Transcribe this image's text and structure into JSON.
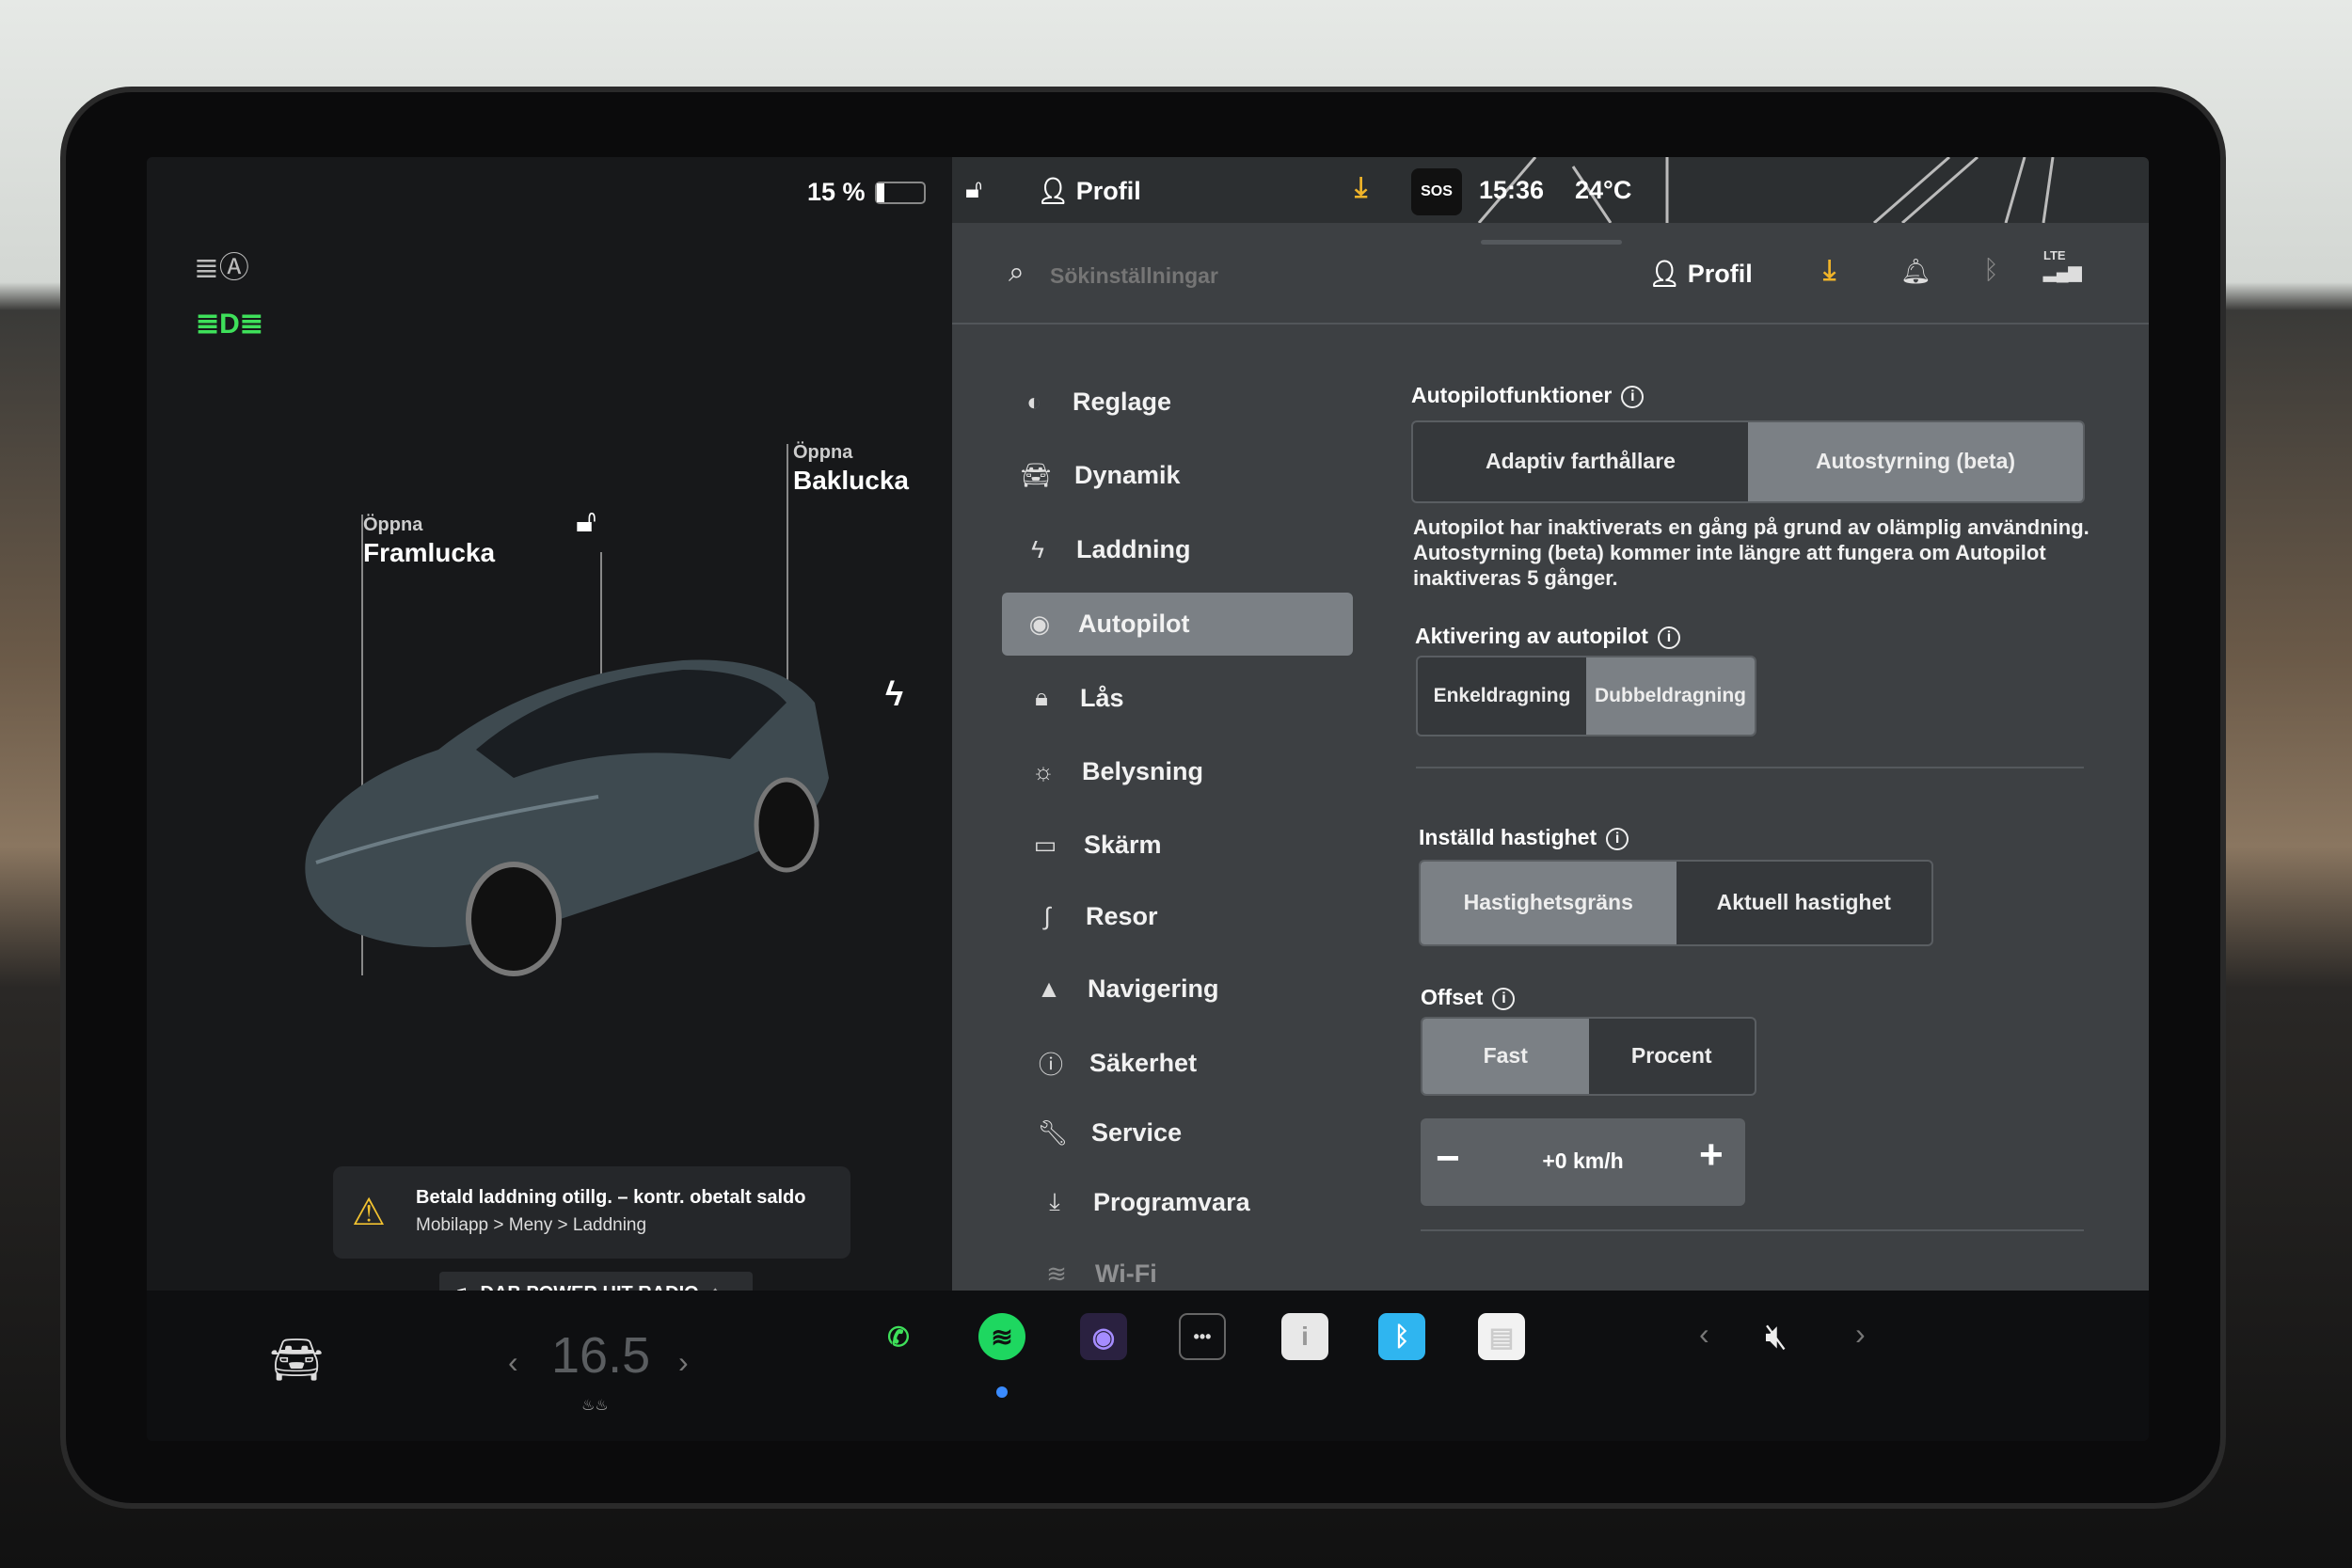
{
  "status": {
    "battery": "15 %",
    "battery_level": 0.15,
    "profile": "Profil",
    "sos": "SOS",
    "time": "15:36",
    "temperature": "24°C"
  },
  "car": {
    "frunk_top": "Öppna",
    "frunk_bottom": "Framlucka",
    "trunk_top": "Öppna",
    "trunk_bottom": "Baklucka"
  },
  "alert": {
    "title": "Betald laddning otillg. – kontr. obetalt saldo",
    "subtitle": "Mobilapp > Meny > Laddning"
  },
  "media": {
    "station": "DAB POWER HIT RADIO"
  },
  "climate": {
    "temp": "16.5"
  },
  "search": {
    "placeholder": "Sökinställningar"
  },
  "header": {
    "profile": "Profil",
    "lte": "LTE"
  },
  "sidebar": {
    "items": [
      {
        "label": "Reglage",
        "icon": "toggle-icon"
      },
      {
        "label": "Dynamik",
        "icon": "car-icon"
      },
      {
        "label": "Laddning",
        "icon": "bolt-icon"
      },
      {
        "label": "Autopilot",
        "icon": "steering-wheel-icon",
        "selected": true
      },
      {
        "label": "Lås",
        "icon": "lock-icon"
      },
      {
        "label": "Belysning",
        "icon": "sun-icon"
      },
      {
        "label": "Skärm",
        "icon": "display-icon"
      },
      {
        "label": "Resor",
        "icon": "trips-icon"
      },
      {
        "label": "Navigering",
        "icon": "navigation-icon"
      },
      {
        "label": "Säkerhet",
        "icon": "safety-icon"
      },
      {
        "label": "Service",
        "icon": "wrench-icon"
      },
      {
        "label": "Programvara",
        "icon": "download-icon"
      },
      {
        "label": "Wi-Fi",
        "icon": "wifi-icon"
      }
    ]
  },
  "autopilot": {
    "features_title": "Autopilotfunktioner",
    "features_options": [
      "Adaptiv farthållare",
      "Autostyrning (beta)"
    ],
    "features_selected": 1,
    "warning": "Autopilot har inaktiverats en gång på grund av olämplig användning. Autostyrning (beta) kommer inte längre att fungera om Autopilot inaktiveras 5 gånger.",
    "activation_title": "Aktivering av autopilot",
    "activation_options": [
      "Enkeldragning",
      "Dubbeldragning"
    ],
    "activation_selected": 1,
    "speed_title": "Inställd hastighet",
    "speed_options": [
      "Hastighetsgräns",
      "Aktuell hastighet"
    ],
    "speed_selected": 0,
    "offset_title": "Offset",
    "offset_options": [
      "Fast",
      "Procent"
    ],
    "offset_selected": 0,
    "offset_value": "+0 km/h"
  },
  "colors": {
    "accent_green": "#3ee05a",
    "spotify": "#1ed760",
    "warning": "#f2c230",
    "download": "#f0b429",
    "bluetooth": "#2fb5f0"
  }
}
